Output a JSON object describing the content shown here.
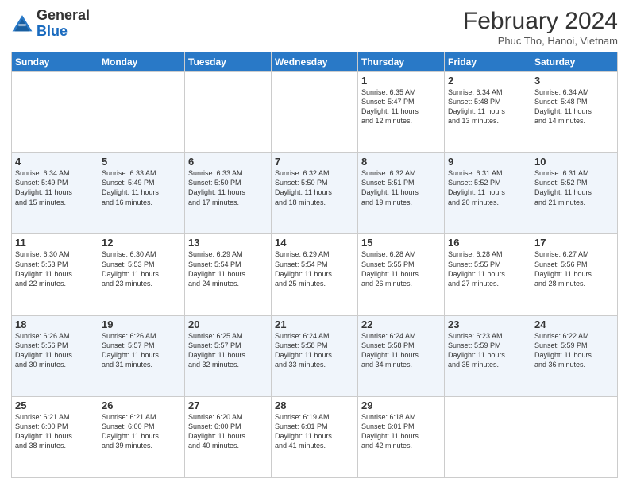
{
  "header": {
    "logo": {
      "line1": "General",
      "line2": "Blue"
    },
    "title": "February 2024",
    "subtitle": "Phuc Tho, Hanoi, Vietnam"
  },
  "days_of_week": [
    "Sunday",
    "Monday",
    "Tuesday",
    "Wednesday",
    "Thursday",
    "Friday",
    "Saturday"
  ],
  "weeks": [
    [
      {
        "day": "",
        "info": ""
      },
      {
        "day": "",
        "info": ""
      },
      {
        "day": "",
        "info": ""
      },
      {
        "day": "",
        "info": ""
      },
      {
        "day": "1",
        "info": "Sunrise: 6:35 AM\nSunset: 5:47 PM\nDaylight: 11 hours\nand 12 minutes."
      },
      {
        "day": "2",
        "info": "Sunrise: 6:34 AM\nSunset: 5:48 PM\nDaylight: 11 hours\nand 13 minutes."
      },
      {
        "day": "3",
        "info": "Sunrise: 6:34 AM\nSunset: 5:48 PM\nDaylight: 11 hours\nand 14 minutes."
      }
    ],
    [
      {
        "day": "4",
        "info": "Sunrise: 6:34 AM\nSunset: 5:49 PM\nDaylight: 11 hours\nand 15 minutes."
      },
      {
        "day": "5",
        "info": "Sunrise: 6:33 AM\nSunset: 5:49 PM\nDaylight: 11 hours\nand 16 minutes."
      },
      {
        "day": "6",
        "info": "Sunrise: 6:33 AM\nSunset: 5:50 PM\nDaylight: 11 hours\nand 17 minutes."
      },
      {
        "day": "7",
        "info": "Sunrise: 6:32 AM\nSunset: 5:50 PM\nDaylight: 11 hours\nand 18 minutes."
      },
      {
        "day": "8",
        "info": "Sunrise: 6:32 AM\nSunset: 5:51 PM\nDaylight: 11 hours\nand 19 minutes."
      },
      {
        "day": "9",
        "info": "Sunrise: 6:31 AM\nSunset: 5:52 PM\nDaylight: 11 hours\nand 20 minutes."
      },
      {
        "day": "10",
        "info": "Sunrise: 6:31 AM\nSunset: 5:52 PM\nDaylight: 11 hours\nand 21 minutes."
      }
    ],
    [
      {
        "day": "11",
        "info": "Sunrise: 6:30 AM\nSunset: 5:53 PM\nDaylight: 11 hours\nand 22 minutes."
      },
      {
        "day": "12",
        "info": "Sunrise: 6:30 AM\nSunset: 5:53 PM\nDaylight: 11 hours\nand 23 minutes."
      },
      {
        "day": "13",
        "info": "Sunrise: 6:29 AM\nSunset: 5:54 PM\nDaylight: 11 hours\nand 24 minutes."
      },
      {
        "day": "14",
        "info": "Sunrise: 6:29 AM\nSunset: 5:54 PM\nDaylight: 11 hours\nand 25 minutes."
      },
      {
        "day": "15",
        "info": "Sunrise: 6:28 AM\nSunset: 5:55 PM\nDaylight: 11 hours\nand 26 minutes."
      },
      {
        "day": "16",
        "info": "Sunrise: 6:28 AM\nSunset: 5:55 PM\nDaylight: 11 hours\nand 27 minutes."
      },
      {
        "day": "17",
        "info": "Sunrise: 6:27 AM\nSunset: 5:56 PM\nDaylight: 11 hours\nand 28 minutes."
      }
    ],
    [
      {
        "day": "18",
        "info": "Sunrise: 6:26 AM\nSunset: 5:56 PM\nDaylight: 11 hours\nand 30 minutes."
      },
      {
        "day": "19",
        "info": "Sunrise: 6:26 AM\nSunset: 5:57 PM\nDaylight: 11 hours\nand 31 minutes."
      },
      {
        "day": "20",
        "info": "Sunrise: 6:25 AM\nSunset: 5:57 PM\nDaylight: 11 hours\nand 32 minutes."
      },
      {
        "day": "21",
        "info": "Sunrise: 6:24 AM\nSunset: 5:58 PM\nDaylight: 11 hours\nand 33 minutes."
      },
      {
        "day": "22",
        "info": "Sunrise: 6:24 AM\nSunset: 5:58 PM\nDaylight: 11 hours\nand 34 minutes."
      },
      {
        "day": "23",
        "info": "Sunrise: 6:23 AM\nSunset: 5:59 PM\nDaylight: 11 hours\nand 35 minutes."
      },
      {
        "day": "24",
        "info": "Sunrise: 6:22 AM\nSunset: 5:59 PM\nDaylight: 11 hours\nand 36 minutes."
      }
    ],
    [
      {
        "day": "25",
        "info": "Sunrise: 6:21 AM\nSunset: 6:00 PM\nDaylight: 11 hours\nand 38 minutes."
      },
      {
        "day": "26",
        "info": "Sunrise: 6:21 AM\nSunset: 6:00 PM\nDaylight: 11 hours\nand 39 minutes."
      },
      {
        "day": "27",
        "info": "Sunrise: 6:20 AM\nSunset: 6:00 PM\nDaylight: 11 hours\nand 40 minutes."
      },
      {
        "day": "28",
        "info": "Sunrise: 6:19 AM\nSunset: 6:01 PM\nDaylight: 11 hours\nand 41 minutes."
      },
      {
        "day": "29",
        "info": "Sunrise: 6:18 AM\nSunset: 6:01 PM\nDaylight: 11 hours\nand 42 minutes."
      },
      {
        "day": "",
        "info": ""
      },
      {
        "day": "",
        "info": ""
      }
    ]
  ]
}
